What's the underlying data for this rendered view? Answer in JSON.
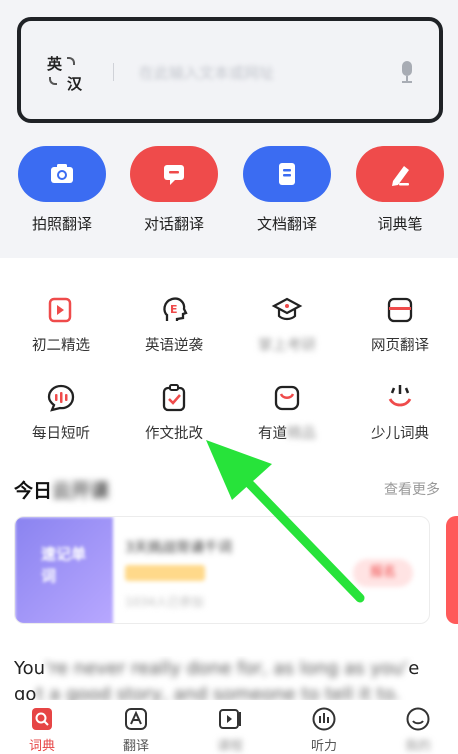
{
  "search": {
    "lang_from": "英",
    "lang_to": "汉",
    "placeholder": "在此输入文本或网址"
  },
  "features": [
    {
      "label": "拍照翻译",
      "color": "#3b6cf2",
      "icon": "camera-icon"
    },
    {
      "label": "对话翻译",
      "color": "#ef4b4b",
      "icon": "chat-icon"
    },
    {
      "label": "文档翻译",
      "color": "#3b6cf2",
      "icon": "document-icon"
    },
    {
      "label": "词典笔",
      "color": "#ef4b4b",
      "icon": "pen-icon"
    }
  ],
  "grid": [
    {
      "label": "初二精选",
      "icon": "video-icon"
    },
    {
      "label": "英语逆袭",
      "icon": "head-e-icon"
    },
    {
      "label": "掌上考研",
      "icon": "graduation-cap-icon"
    },
    {
      "label": "网页翻译",
      "icon": "webpage-icon"
    },
    {
      "label": "每日短听",
      "icon": "audio-bubble-icon"
    },
    {
      "label": "作文批改",
      "icon": "essay-check-icon"
    },
    {
      "label_visible": "有道",
      "label_blurred": "精品",
      "icon": "youdao-icon"
    },
    {
      "label": "少儿词典",
      "icon": "kids-dict-icon"
    }
  ],
  "section": {
    "title_visible": "今日",
    "title_blurred": "云开课",
    "see_more": "查看更多"
  },
  "card": {
    "thumb_text": "速记单词",
    "title": "3天挑战背诵千词",
    "subtitle": "1034人已参加",
    "button": "报名"
  },
  "quote": {
    "line1_visible": "You",
    "line1_blurred": "'re never really done for, as long as you'",
    "line1_end": "e",
    "line2_visible": "go",
    "line2_blurred": "t a good story, and someone to tell it to."
  },
  "nav": [
    {
      "label": "词典",
      "icon": "dictionary-icon",
      "active": true
    },
    {
      "label": "翻译",
      "icon": "translate-icon",
      "active": false
    },
    {
      "label": "课程",
      "icon": "course-icon",
      "active": false
    },
    {
      "label": "听力",
      "icon": "listening-icon",
      "active": false
    },
    {
      "label": "我的",
      "icon": "profile-icon",
      "active": false
    }
  ],
  "colors": {
    "accent_red": "#ef4b4b",
    "accent_blue": "#3b6cf2",
    "annotation_arrow": "#27e33a"
  }
}
